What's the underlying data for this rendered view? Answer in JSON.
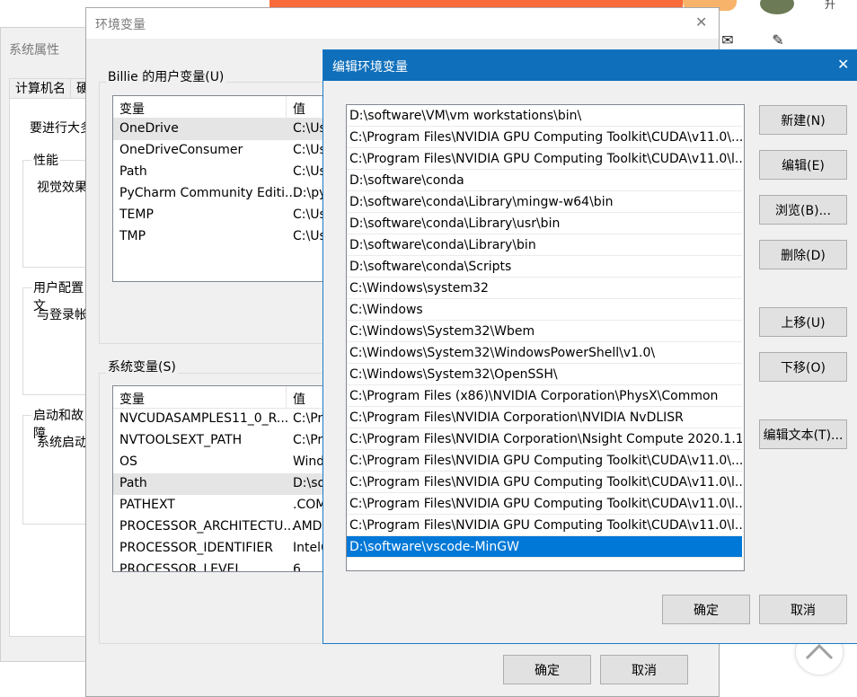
{
  "background": {
    "right_text": "升",
    "colors": {
      "banner": "#f96a3a"
    }
  },
  "sysprop": {
    "title": "系统属性",
    "tabs": [
      "计算机名",
      "硬"
    ],
    "intro_text": "要进行大多",
    "performance": {
      "label": "性能",
      "text": "视觉效果"
    },
    "user_profiles": {
      "label": "用户配置文",
      "text": "与登录帐"
    },
    "startup": {
      "label": "启动和故障",
      "text": "系统启动"
    }
  },
  "env": {
    "title": "环境变量",
    "user_vars_label": "Billie 的用户变量(U)",
    "columns": [
      "变量",
      "值"
    ],
    "user_vars": [
      {
        "name": "OneDrive",
        "value": "C:\\Us"
      },
      {
        "name": "OneDriveConsumer",
        "value": "C:\\Us"
      },
      {
        "name": "Path",
        "value": "C:\\Us"
      },
      {
        "name": "PyCharm Community Editi...",
        "value": "D:\\py"
      },
      {
        "name": "TEMP",
        "value": "C:\\Us"
      },
      {
        "name": "TMP",
        "value": "C:\\Us"
      }
    ],
    "sys_vars_label": "系统变量(S)",
    "sys_vars": [
      {
        "name": "NVCUDASAMPLES11_0_R...",
        "value": "C:\\Pro"
      },
      {
        "name": "NVTOOLSEXT_PATH",
        "value": "C:\\Pro"
      },
      {
        "name": "OS",
        "value": "Wind"
      },
      {
        "name": "Path",
        "value": "D:\\so"
      },
      {
        "name": "PATHEXT",
        "value": ".COM"
      },
      {
        "name": "PROCESSOR_ARCHITECTU...",
        "value": "AMD"
      },
      {
        "name": "PROCESSOR_IDENTIFIER",
        "value": "Intel6"
      },
      {
        "name": "PROCESSOR_LEVEL",
        "value": "6"
      }
    ],
    "ok_label": "确定",
    "cancel_label": "取消"
  },
  "edit": {
    "title": "编辑环境变量",
    "paths": [
      "D:\\software\\VM\\vm workstations\\bin\\",
      "C:\\Program Files\\NVIDIA GPU Computing Toolkit\\CUDA\\v11.0\\...",
      "C:\\Program Files\\NVIDIA GPU Computing Toolkit\\CUDA\\v11.0\\l...",
      "D:\\software\\conda",
      "D:\\software\\conda\\Library\\mingw-w64\\bin",
      "D:\\software\\conda\\Library\\usr\\bin",
      "D:\\software\\conda\\Library\\bin",
      "D:\\software\\conda\\Scripts",
      "C:\\Windows\\system32",
      "C:\\Windows",
      "C:\\Windows\\System32\\Wbem",
      "C:\\Windows\\System32\\WindowsPowerShell\\v1.0\\",
      "C:\\Windows\\System32\\OpenSSH\\",
      "C:\\Program Files (x86)\\NVIDIA Corporation\\PhysX\\Common",
      "C:\\Program Files\\NVIDIA Corporation\\NVIDIA NvDLISR",
      "C:\\Program Files\\NVIDIA Corporation\\Nsight Compute 2020.1.1\\",
      "C:\\Program Files\\NVIDIA GPU Computing Toolkit\\CUDA\\v11.0\\...",
      "C:\\Program Files\\NVIDIA GPU Computing Toolkit\\CUDA\\v11.0\\l...",
      "C:\\Program Files\\NVIDIA GPU Computing Toolkit\\CUDA\\v11.0\\l...",
      "C:\\Program Files\\NVIDIA GPU Computing Toolkit\\CUDA\\v11.0\\l...",
      "D:\\software\\vscode-MinGW"
    ],
    "selected_index": 20,
    "buttons": {
      "new": "新建(N)",
      "edit": "编辑(E)",
      "browse": "浏览(B)...",
      "delete": "删除(D)",
      "move_up": "上移(U)",
      "move_down": "下移(O)",
      "edit_text": "编辑文本(T)...",
      "ok": "确定",
      "cancel": "取消"
    }
  },
  "colors": {
    "titlebar_accent": "#0f6fbb",
    "selection": "#0078d7",
    "window_bg": "#f0f0f0"
  }
}
